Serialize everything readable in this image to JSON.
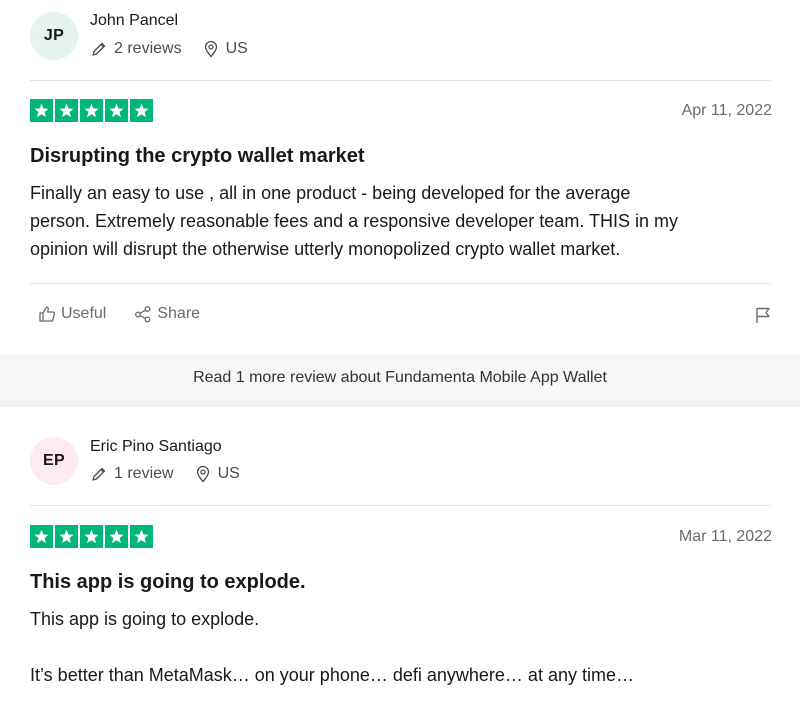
{
  "reviews": [
    {
      "initials": "JP",
      "avatar_color": "#e6f2ef",
      "name": "John Pancel",
      "review_count": "2 reviews",
      "country": "US",
      "rating": 5,
      "date": "Apr 11, 2022",
      "title": "Disrupting the crypto wallet market",
      "body_lines": [
        "Finally an easy to use , all in one product - being developed for the average",
        "person. Extremely reasonable fees and a responsive developer team. THIS in my",
        "opinion will disrupt the otherwise utterly monopolized crypto wallet market."
      ],
      "actions": {
        "useful": "Useful",
        "share": "Share"
      }
    },
    {
      "initials": "EP",
      "avatar_color": "#fdebf1",
      "name": "Eric Pino Santiago",
      "review_count": "1 review",
      "country": "US",
      "rating": 5,
      "date": "Mar 11, 2022",
      "title": "This app is going to explode.",
      "body_lines": [
        "This app is going to explode.",
        "",
        "It’s better than MetaMask… on your phone… defi anywhere… at any time…"
      ]
    }
  ],
  "read_more": "Read 1 more review about Fundamenta Mobile App Wallet",
  "colors": {
    "star_green": "#00b67a"
  },
  "icons": [
    "pencil-icon",
    "location-pin-icon",
    "thumbs-up-icon",
    "share-icon",
    "flag-icon",
    "star-icon"
  ]
}
